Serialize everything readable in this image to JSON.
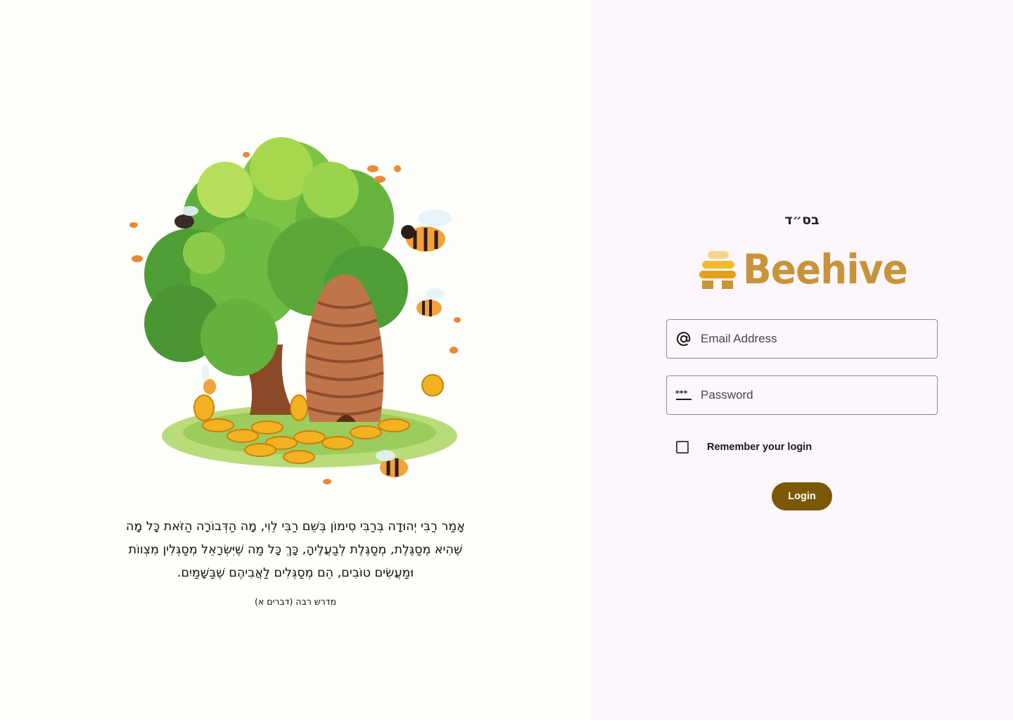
{
  "left": {
    "quote_lines": [
      "אָמַר רַבִּי יְהוּדָה בְּרַבִּי סִימוֹן בְּשֵׁם רַבִּי לֵוִי, מָה הַדְּבוֹרָה הַזֹּאת כָּל מָה",
      "שֶׁהִיא מְסַגֶּלֶת, מְסַגֶּלֶת לְבַעֲלֶיהָ, כָּךְ כָּל מַה שֶּׁיִּשְׂרָאֵל מְסַגְּלִין מִצְווֹת",
      "וּמַעֲשִׂים טוֹבִים, הֵם מְסַגְּלִים לַאֲבִיהֶם שֶׁבַּשָּׁמַיִם."
    ],
    "quote_source": "מדרש רבה (דברים א)",
    "illustration_icon": "beehive-tree-illustration"
  },
  "right": {
    "bsd": "בס״ד",
    "logo_text": "Beehive",
    "email": {
      "placeholder": "Email Address",
      "value": "",
      "icon": "at-sign-icon"
    },
    "password": {
      "placeholder": "Password",
      "value": "",
      "icon": "password-asterisks-icon"
    },
    "remember_label": "Remember your login",
    "remember_checked": false,
    "login_label": "Login"
  },
  "colors": {
    "left_bg": "#fefefa",
    "right_bg": "#fdf6fc",
    "brand": "#c8943a",
    "button": "#7a5805"
  }
}
